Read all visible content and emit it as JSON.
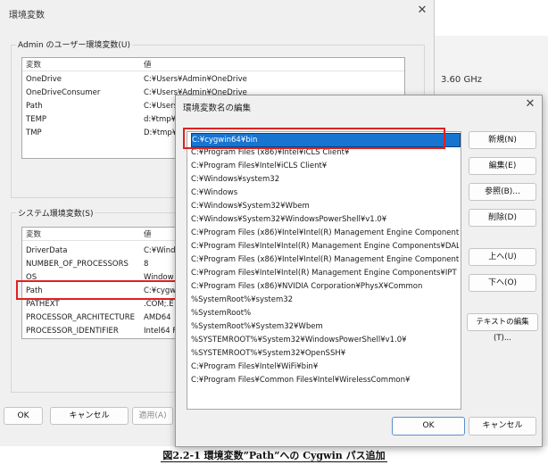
{
  "background": {
    "cpu_speed": "3.60 GHz"
  },
  "env_dialog": {
    "title": "環境変数",
    "user_group_label": "Admin のユーザー環境変数(U)",
    "user_headers": [
      "変数",
      "値"
    ],
    "user_vars": [
      {
        "name": "OneDrive",
        "value": "C:¥Users¥Admin¥OneDrive"
      },
      {
        "name": "OneDriveConsumer",
        "value": "C:¥Users¥Admin¥OneDrive"
      },
      {
        "name": "Path",
        "value": "C:¥Users¥"
      },
      {
        "name": "TEMP",
        "value": "d:¥tmp¥"
      },
      {
        "name": "TMP",
        "value": "D:¥tmp¥"
      }
    ],
    "system_group_label": "システム環境変数(S)",
    "system_headers": [
      "変数",
      "値"
    ],
    "system_vars": [
      {
        "name": "DriverData",
        "value": "C:¥Windo"
      },
      {
        "name": "NUMBER_OF_PROCESSORS",
        "value": "8"
      },
      {
        "name": "OS",
        "value": "Window"
      },
      {
        "name": "Path",
        "value": "C:¥cygw"
      },
      {
        "name": "PATHEXT",
        "value": ".COM;.E"
      },
      {
        "name": "PROCESSOR_ARCHITECTURE",
        "value": "AMD64"
      },
      {
        "name": "PROCESSOR_IDENTIFIER",
        "value": "Intel64 F"
      }
    ],
    "ok_label": "OK",
    "cancel_label": "キャンセル",
    "apply_label": "適用(A)"
  },
  "edit_dialog": {
    "title": "環境変数名の編集",
    "paths": [
      "C:¥cygwin64¥bin",
      "C:¥Program Files (x86)¥Intel¥iCLS Client¥",
      "C:¥Program Files¥Intel¥iCLS Client¥",
      "C:¥Windows¥system32",
      "C:¥Windows",
      "C:¥Windows¥System32¥Wbem",
      "C:¥Windows¥System32¥WindowsPowerShell¥v1.0¥",
      "C:¥Program Files (x86)¥Intel¥Intel(R) Management Engine Components...",
      "C:¥Program Files¥Intel¥Intel(R) Management Engine Components¥DAL",
      "C:¥Program Files (x86)¥Intel¥Intel(R) Management Engine Components...",
      "C:¥Program Files¥Intel¥Intel(R) Management Engine Components¥IPT",
      "C:¥Program Files (x86)¥NVIDIA Corporation¥PhysX¥Common",
      "%SystemRoot%¥system32",
      "%SystemRoot%",
      "%SystemRoot%¥System32¥Wbem",
      "%SYSTEMROOT%¥System32¥WindowsPowerShell¥v1.0¥",
      "%SYSTEMROOT%¥System32¥OpenSSH¥",
      "C:¥Program Files¥Intel¥WiFi¥bin¥",
      "C:¥Program Files¥Common Files¥Intel¥WirelessCommon¥"
    ],
    "buttons": {
      "new": "新規(N)",
      "edit": "編集(E)",
      "browse": "参照(B)...",
      "delete": "削除(D)",
      "up": "上へ(U)",
      "down": "下へ(O)",
      "edit_text": "テキストの編集(T)..."
    },
    "ok_label": "OK",
    "cancel_label": "キャンセル"
  },
  "caption": "図2.2-1 環境変数”Path”への Cygwin パス追加"
}
